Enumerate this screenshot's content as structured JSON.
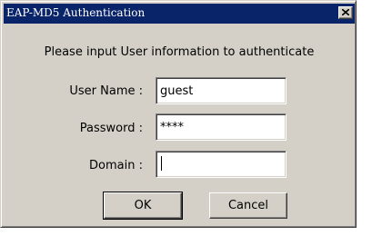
{
  "window": {
    "title": "EAP-MD5 Authentication",
    "close_icon": "close-icon"
  },
  "prompt": "Please input User information to authenticate",
  "fields": {
    "username": {
      "label": "User Name :",
      "value": "guest"
    },
    "password": {
      "label": "Password :",
      "value": "****"
    },
    "domain": {
      "label": "Domain :",
      "value": ""
    }
  },
  "buttons": {
    "ok": "OK",
    "cancel": "Cancel"
  },
  "colors": {
    "titlebar": "#0a246a",
    "dialog_face": "#d4d0c8",
    "field_background": "#ffffff"
  }
}
